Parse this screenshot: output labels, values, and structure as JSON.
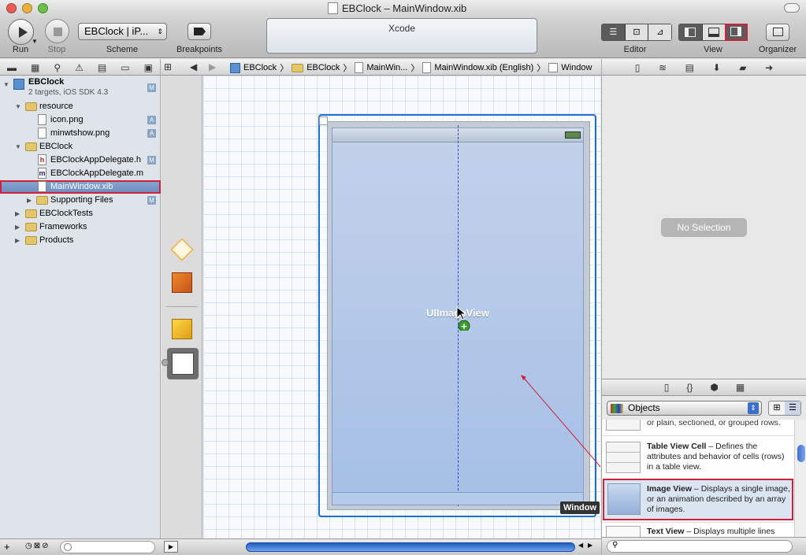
{
  "window": {
    "title": "EBClock – MainWindow.xib"
  },
  "toolbar": {
    "run_label": "Run",
    "stop_label": "Stop",
    "scheme_value": "EBClock | iP...",
    "scheme_label": "Scheme",
    "breakpoints_label": "Breakpoints",
    "activity_title": "Xcode",
    "editor_label": "Editor",
    "view_label": "View",
    "organizer_label": "Organizer"
  },
  "jumpbar": {
    "crumbs": [
      "EBClock",
      "EBClock",
      "MainWin...",
      "MainWindow.xib (English)",
      "Window"
    ]
  },
  "navigator": {
    "project": {
      "name": "EBClock",
      "subtitle": "2 targets, iOS SDK 4.3",
      "badge": "M"
    },
    "items": [
      {
        "label": "resource",
        "badge": ""
      },
      {
        "label": "icon.png",
        "badge": "A"
      },
      {
        "label": "minwtshow.png",
        "badge": "A"
      },
      {
        "label": "EBClock",
        "badge": ""
      },
      {
        "label": "EBClockAppDelegate.h",
        "badge": "M"
      },
      {
        "label": "EBClockAppDelegate.m",
        "badge": ""
      },
      {
        "label": "MainWindow.xib",
        "badge": ""
      },
      {
        "label": "Supporting Files",
        "badge": "M"
      },
      {
        "label": "EBClockTests",
        "badge": ""
      },
      {
        "label": "Frameworks",
        "badge": ""
      },
      {
        "label": "Products",
        "badge": ""
      }
    ],
    "file_glyphs": {
      "header": "h",
      "impl": "m"
    }
  },
  "canvas": {
    "view_label": "UIImageView",
    "window_tooltip": "Window"
  },
  "inspector": {
    "no_selection": "No Selection"
  },
  "library": {
    "popup_value": "Objects",
    "partial_text": "or plain, sectioned, or grouped rows.",
    "entries": [
      {
        "title": "Table View Cell",
        "desc": " – Defines the attributes and behavior of cells (rows) in a table view."
      },
      {
        "title": "Image View",
        "desc": " – Displays a single image, or an animation described by an array of images."
      },
      {
        "title": "Text View",
        "desc": " – Displays multiple lines"
      }
    ]
  },
  "colors": {
    "selection_outline": "#d0213c",
    "accent": "#1b6fd6",
    "view_fill": "#b3c8e8"
  }
}
